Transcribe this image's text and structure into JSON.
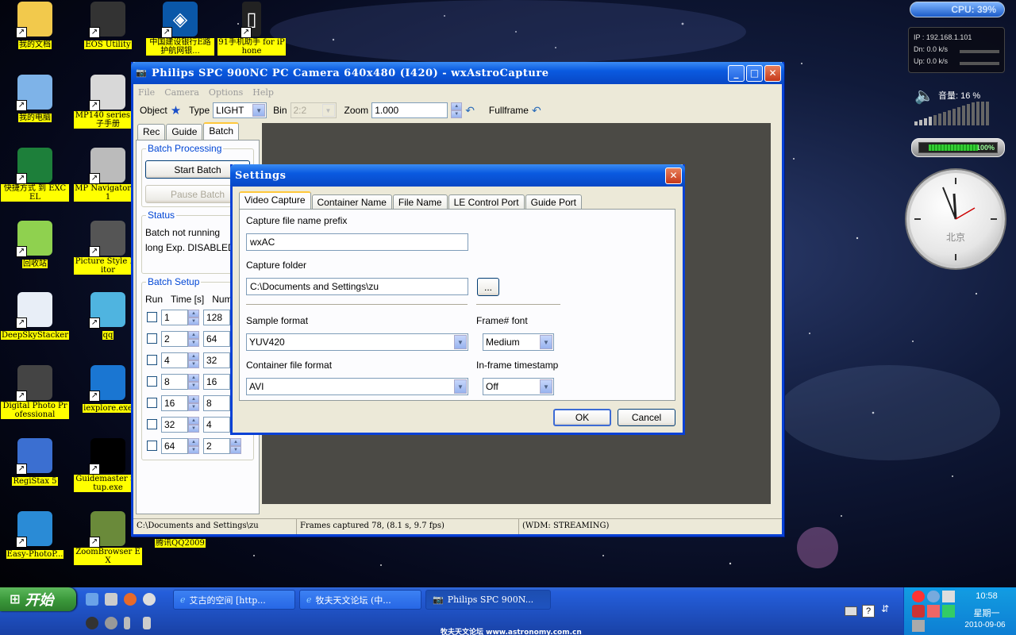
{
  "desktop": {
    "icons_left": [
      {
        "label": "我的文档",
        "icon": "folder-icon",
        "color": "#f2c94c"
      },
      {
        "label": "我的电脑",
        "icon": "computer-icon",
        "color": "#7eb3e8"
      },
      {
        "label": "快捷方式 到 EXCEL",
        "icon": "excel-icon",
        "color": "#1d7f3a"
      },
      {
        "label": "回收站",
        "icon": "recycle-bin-icon",
        "color": "#8fd14f"
      },
      {
        "label": "DeepSkyStacker",
        "icon": "document-icon",
        "color": "#e8eef7"
      },
      {
        "label": "Digital Photo Professional",
        "icon": "photo-icon",
        "color": "#444"
      },
      {
        "label": "RegiStax 5",
        "icon": "registax-icon",
        "color": "#3b6fd1"
      },
      {
        "label": "Easy-PhotoP...",
        "icon": "photoprint-icon",
        "color": "#2a8bd6"
      }
    ],
    "icons_right": [
      {
        "label": "EOS Utility",
        "icon": "camera-icon",
        "color": "#333"
      },
      {
        "label": "MP140 series 电子手册",
        "icon": "manual-icon",
        "color": "#d8d8d8"
      },
      {
        "label": "MP Navigator 3.1",
        "icon": "printer-icon",
        "color": "#bbb"
      },
      {
        "label": "Picture Style Editor",
        "icon": "style-editor-icon",
        "color": "#555"
      },
      {
        "label": "qq",
        "icon": "qq-icon",
        "color": "#4fb4e0"
      },
      {
        "label": "iexplore.exe",
        "icon": "ie-icon",
        "color": "#1a76d2"
      },
      {
        "label": "Guidemaster Setup.exe",
        "icon": "guidemaster-icon",
        "color": "#000"
      },
      {
        "label": "ZoomBrowser EX",
        "icon": "zoombrowser-icon",
        "color": "#6a8a3a"
      }
    ],
    "icons_top": [
      {
        "label": "中国建设银行E路护航网银...",
        "icon": "bank-icon",
        "color": "#0a57a8"
      },
      {
        "label": "91手机助手 for iPhone",
        "icon": "phone-icon",
        "color": "#222"
      }
    ],
    "qq2009_label": "腾讯QQ2009"
  },
  "gadgets": {
    "cpu": "CPU: 39%",
    "ip": "IP : 192.168.1.101",
    "dn": "Dn: 0.0 k/s",
    "up": "Up: 0.0 k/s",
    "volume_label": "音量:  16 %",
    "battery": "100%",
    "clock_city": "北京"
  },
  "main_window": {
    "title": "Philips SPC 900NC PC Camera 640x480 (I420) - wxAstroCapture",
    "menu": [
      "File",
      "Camera",
      "Options",
      "Help"
    ],
    "toolbar": {
      "object_label": "Object",
      "type_label": "Type",
      "type_value": "LIGHT",
      "bin_label": "Bin",
      "bin_value": "2:2",
      "zoom_label": "Zoom",
      "zoom_value": "1.000",
      "fullframe_label": "Fullframe"
    },
    "tabs": [
      "Rec",
      "Guide",
      "Batch"
    ],
    "batch": {
      "processing_title": "Batch Processing",
      "start_button": "Start Batch",
      "pause_button": "Pause Batch",
      "status_title": "Status",
      "status_line1": "Batch not running",
      "status_line2": "long Exp. DISABLED",
      "setup_title": "Batch Setup",
      "col_run": "Run",
      "col_time": "Time [s]",
      "col_num": "Num",
      "rows": [
        {
          "time": "1",
          "num": "128"
        },
        {
          "time": "2",
          "num": "64"
        },
        {
          "time": "4",
          "num": "32"
        },
        {
          "time": "8",
          "num": "16"
        },
        {
          "time": "16",
          "num": "8"
        },
        {
          "time": "32",
          "num": "4"
        },
        {
          "time": "64",
          "num": "2"
        }
      ]
    },
    "status": {
      "path": "C:\\Documents and Settings\\zu",
      "frames": "Frames captured 78,  (8.1 s, 9.7 fps)",
      "mode": "(WDM: STREAMING)"
    }
  },
  "settings_dialog": {
    "title": "Settings",
    "tabs": [
      "Video Capture",
      "Container Name",
      "File Name",
      "LE Control Port",
      "Guide Port"
    ],
    "prefix_label": "Capture file name prefix",
    "prefix_value": "wxAC",
    "folder_label": "Capture folder",
    "folder_value": "C:\\Documents and Settings\\zu",
    "browse_label": "...",
    "sample_format_label": "Sample format",
    "sample_format_value": "YUV420",
    "frame_font_label": "Frame# font",
    "frame_font_value": "Medium",
    "container_format_label": "Container file format",
    "container_format_value": "AVI",
    "timestamp_label": "In-frame timestamp",
    "timestamp_value": "Off",
    "ok": "OK",
    "cancel": "Cancel"
  },
  "taskbar": {
    "start": "开始",
    "tasks": [
      {
        "label": "艾古的空间 [http...",
        "icon": "ie-icon"
      },
      {
        "label": "牧夫天文论坛 (中...",
        "icon": "ie-icon"
      },
      {
        "label": "Philips SPC 900N...",
        "icon": "camera-icon"
      }
    ],
    "time": "10:58",
    "weekday": "星期一",
    "date": "2010-09-06"
  },
  "footer": "牧夫天文论坛 www.astronomy.com.cn"
}
